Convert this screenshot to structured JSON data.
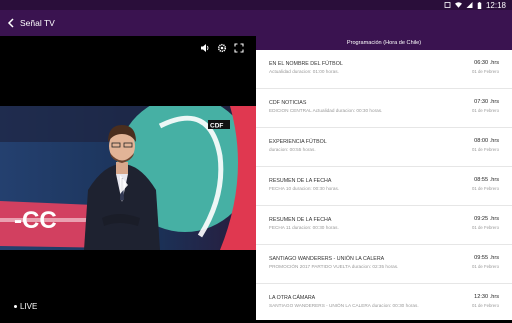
{
  "status_bar": {
    "time": "12:18",
    "icons": [
      "sim-icon",
      "wifi-icon",
      "signal-icon",
      "battery-icon"
    ]
  },
  "app_bar": {
    "title": "Señal TV",
    "back_icon": "chevron-left-icon"
  },
  "player": {
    "controls": [
      "volume-icon",
      "settings-gear-icon",
      "fullscreen-icon"
    ],
    "live_label": "LIVE",
    "channel_logo": "CDF",
    "video_overlay_text": "-CC"
  },
  "schedule": {
    "header": "Programación (Hora de Chile)",
    "items": [
      {
        "name": "EN EL NOMBRE DEL FÚTBOL",
        "subtitle": "Actualidad duracion: 01:00 horas.",
        "time": "06:30 .hrs",
        "date": "01 de Febrero"
      },
      {
        "name": "CDF NOTICIAS",
        "subtitle": "EDICION CENTRAL Actualidad duracion: 00:30 horas.",
        "time": "07:30 .hrs",
        "date": "01 de Febrero"
      },
      {
        "name": "EXPERIENCIA FÚTBOL",
        "subtitle": "duracion: 00:55 horas.",
        "time": "08:00 .hrs",
        "date": "01 de Febrero"
      },
      {
        "name": "RESUMEN DE LA FECHA",
        "subtitle": "FECHA 10 duracion: 00:30 horas.",
        "time": "08:55 .hrs",
        "date": "01 de Febrero"
      },
      {
        "name": "RESUMEN DE LA FECHA",
        "subtitle": "FECHA 11 duracion: 00:30 horas.",
        "time": "09:25 .hrs",
        "date": "01 de Febrero"
      },
      {
        "name": "SANTIAGO WANDERERS - UNIÓN LA CALERA",
        "subtitle": "PROMOCIÓN 2017 PARTIDO VUELTA duracion: 02:35 horas.",
        "time": "09:55 .hrs",
        "date": "01 de Febrero"
      },
      {
        "name": "LA OTRA CÁMARA",
        "subtitle": "SANTIAGO WANDERERS - UNIÓN LA CALERA duracion: 00:30 horas.",
        "time": "12:30 .hrs",
        "date": "01 de Febrero"
      }
    ]
  }
}
